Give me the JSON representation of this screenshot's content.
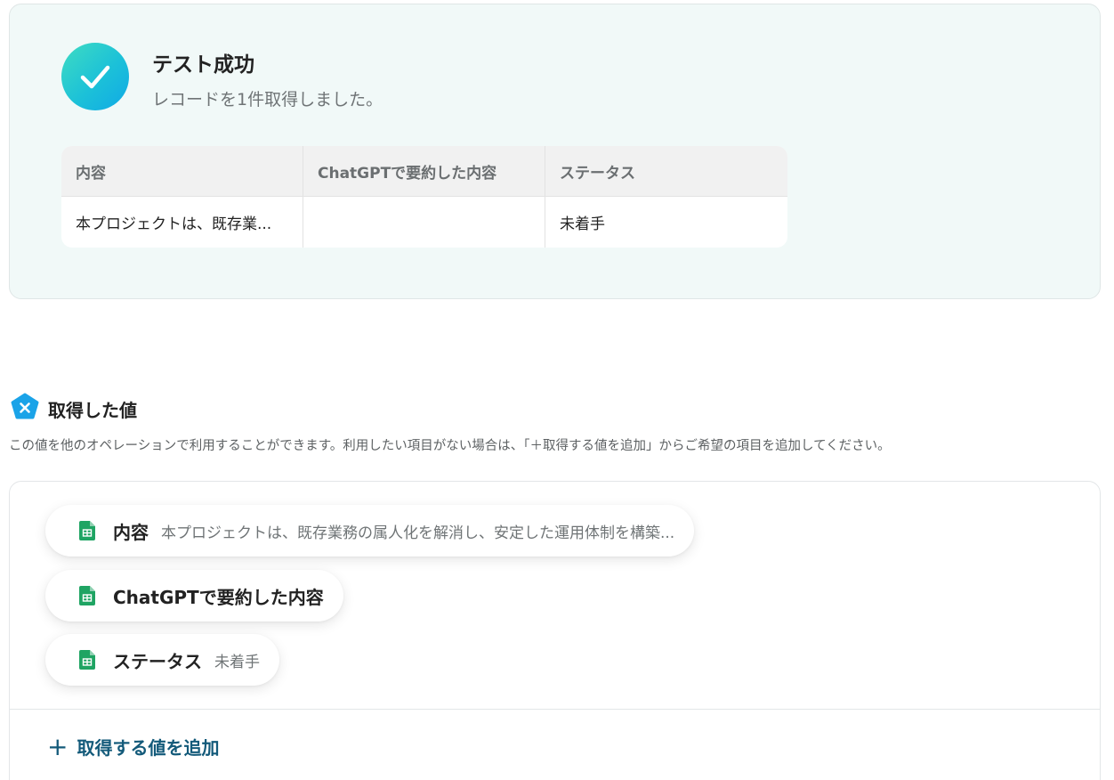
{
  "success": {
    "title": "テスト成功",
    "subtitle": "レコードを1件取得しました。"
  },
  "result_table": {
    "headers": [
      "内容",
      "ChatGPTで要約した内容",
      "ステータス"
    ],
    "rows": [
      [
        "本プロジェクトは、既存業...",
        "",
        "未着手"
      ]
    ]
  },
  "values_section": {
    "icon": "yoom-pentagon-icon",
    "title": "取得した値",
    "description": "この値を他のオペレーションで利用することができます。利用したい項目がない場合は、「＋取得する値を追加」からご希望の項目を追加してください。",
    "items": [
      {
        "label": "内容",
        "value": "本プロジェクトは、既存業務の属人化を解消し、安定した運用体制を構築...",
        "icon": "google-sheets-icon"
      },
      {
        "label": "ChatGPTで要約した内容",
        "value": "",
        "icon": "google-sheets-icon"
      },
      {
        "label": "ステータス",
        "value": "未着手",
        "icon": "google-sheets-icon"
      }
    ],
    "add_button": "取得する値を追加"
  },
  "colors": {
    "success_gradient": [
      "#3fdcc2",
      "#10a9e6"
    ],
    "panel_bg": "#f1f9f8",
    "sheets_green": "#1fa463",
    "link": "#135a7a"
  }
}
